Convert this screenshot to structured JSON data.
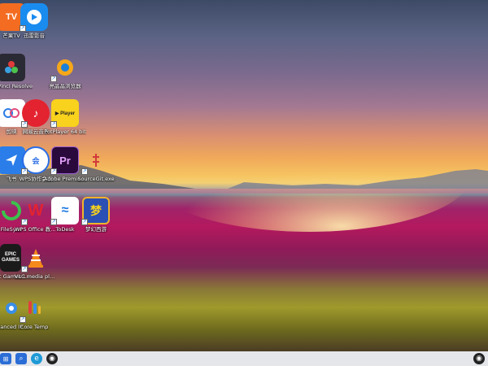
{
  "desktop_icons": [
    {
      "id": "mgtv",
      "label": "芒果TV",
      "text": "TV"
    },
    {
      "id": "xunlei",
      "label": "迅雷影音",
      "text": ""
    },
    {
      "id": "davinci",
      "label": "DaVinci Resolve",
      "text": ""
    },
    {
      "id": "browser",
      "label": "亮晶晶浏览器",
      "text": "e"
    },
    {
      "id": "app1",
      "label": "剪映",
      "text": ""
    },
    {
      "id": "netease",
      "label": "网易云音乐",
      "text": "♪"
    },
    {
      "id": "potplayer",
      "label": "PotPlayer 64 bit",
      "text": "▶ Player"
    },
    {
      "id": "feishu",
      "label": "飞书",
      "text": ""
    },
    {
      "id": "wpsmeeting",
      "label": "WPS协作会议",
      "text": "会"
    },
    {
      "id": "premiere",
      "label": "Adobe Premiere P...",
      "text": "Pr"
    },
    {
      "id": "sourcegit",
      "label": "SourceGit.exe",
      "text": ""
    },
    {
      "id": "app2",
      "label": "FileSync",
      "text": ""
    },
    {
      "id": "wps",
      "label": "WPS Office 教育版",
      "text": "W"
    },
    {
      "id": "todesk",
      "label": "ToDesk",
      "text": "≈"
    },
    {
      "id": "wangzhe",
      "label": "梦幻西游",
      "text": "梦"
    },
    {
      "id": "epic",
      "label": "Epic Games Launcher",
      "text": "EPIC GAMES"
    },
    {
      "id": "vlc",
      "label": "VLC media player",
      "text": ""
    },
    {
      "id": "advip",
      "label": "Advanced IP Scanner",
      "text": ""
    },
    {
      "id": "coretemp",
      "label": "Core Temp",
      "text": ""
    }
  ],
  "taskbar": {
    "start": "⊞",
    "search": "⌕",
    "browser": "e",
    "app": "◉",
    "tray": "◉"
  }
}
